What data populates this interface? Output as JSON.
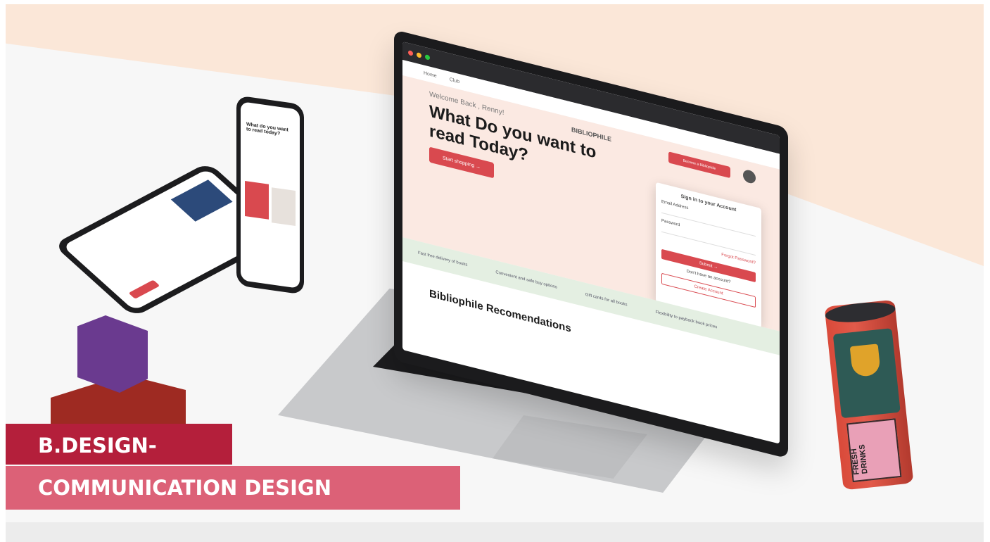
{
  "scene": {
    "caption_line1": "B.DESIGN-",
    "caption_line2": "COMMUNICATION DESIGN",
    "colors": {
      "caption_dark": "#b41f3b",
      "caption_light": "#dc6177",
      "accent_red": "#d9494f",
      "peach_bg": "#fbe7d8"
    }
  },
  "laptop": {
    "brand": "BIBLIOPHILE",
    "nav_items": [
      "Home",
      "Club"
    ],
    "cta": "Become a Bibliophile",
    "hero_welcome": "Welcome Back , Renny!",
    "hero_title": "What Do you want to read Today?",
    "hero_button": "Start shopping →",
    "features": [
      "Fast free delivery of books",
      "Convenient and safe buy options",
      "Gift cards for all books",
      "Flexibility to payback book prices"
    ],
    "section_title": "Bibliophile Recomendations",
    "login": {
      "title": "Sign in to your Account",
      "email_label": "Email Address",
      "password_label": "Password",
      "forgot": "Forgot Password?",
      "button": "Submit →",
      "alt_text": "Don't have an account?",
      "register": "Create Account"
    }
  },
  "phone2": {
    "title": "What do you want to read today?"
  },
  "can": {
    "text": "FRESH DRINKS"
  }
}
